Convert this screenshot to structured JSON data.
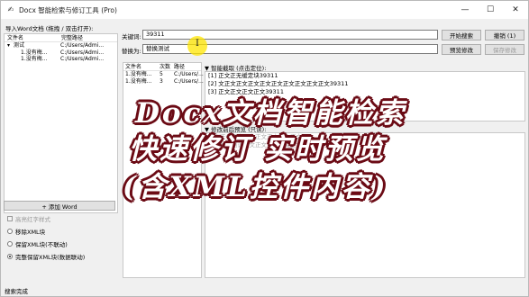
{
  "window": {
    "title": "Docx 智能检索与修订工具 (Pro)",
    "app_icon": "docx-app-icon",
    "minimize": "—",
    "maximize": "☐",
    "close": "✕"
  },
  "left": {
    "label": "导入Word文档 (拖拽 / 双击打开):",
    "tree_headers": [
      "文件名",
      "完整路径"
    ],
    "tree_rows": [
      {
        "indent": 0,
        "expander": "▾",
        "name": "测试",
        "path": "C:/Users/Admi..."
      },
      {
        "indent": 1,
        "expander": "",
        "name": "1.没有梅...",
        "path": "C:/Users/Admi..."
      },
      {
        "indent": 1,
        "expander": "",
        "name": "1.没有梅...",
        "path": "C:/Users/Admi..."
      }
    ],
    "add_button": "+ 添加 Word",
    "options": [
      {
        "type": "checkbox",
        "label": "高亮红字样式",
        "checked": false,
        "disabled": true
      },
      {
        "type": "radio",
        "label": "移除XML块",
        "checked": false,
        "disabled": false
      },
      {
        "type": "radio",
        "label": "保留XML块(不联动)",
        "checked": false,
        "disabled": false
      },
      {
        "type": "radio",
        "label": "完整保留XML块(数据联动)",
        "checked": true,
        "disabled": false
      }
    ]
  },
  "search": {
    "keyword_label": "关键词:",
    "keyword_value": "39311",
    "replace_label": "替换为:",
    "replace_value": "替换测试",
    "search_button": "开始搜索",
    "undo_button": "撤销 (1)",
    "preview_button": "预览修改",
    "save_button": "保存修改"
  },
  "results": {
    "headers": [
      "文件名",
      "次数",
      "路径"
    ],
    "rows": [
      {
        "name": "1.没有梅...",
        "count": "5",
        "path": "C:/Users/..."
      },
      {
        "name": "1.没有梅...",
        "count": "3",
        "path": "C:/Users/..."
      }
    ]
  },
  "snippets": {
    "title": "▼ 智能截取 (点击定位):",
    "lines": [
      "[1] 正文正无缓定块39311",
      "[2] 文正文正文正文正文正文正文正文正文正文39311",
      "[3] 正文正文正文正文39311"
    ]
  },
  "preview": {
    "title": "▼ 修改前后预览 (只读):",
    "lines": [
      "正文正文正文正文正文正文正文正文",
      "正文替换测试正文正文正文正文正文"
    ]
  },
  "status": "搜索完成",
  "overlay": {
    "line1": "Docx文档智能检索",
    "line2": "快速修订 实时预览",
    "line3": "(含XML控件内容)"
  },
  "colors": {
    "overlay_outline": "#6b0a14",
    "cursor_highlight": "#ffe600"
  }
}
